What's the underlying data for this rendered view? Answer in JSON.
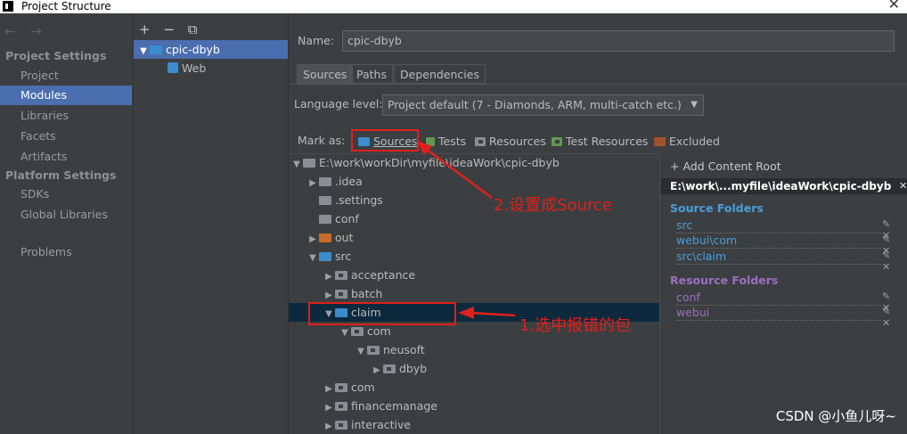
{
  "window": {
    "title": "Project Structure",
    "close_glyph": "✕"
  },
  "sidebar": {
    "nav_arrows": "← →",
    "project_settings_title": "Project Settings",
    "project_settings_items": [
      "Project",
      "Modules",
      "Libraries",
      "Facets",
      "Artifacts"
    ],
    "selected_item": "Modules",
    "platform_settings_title": "Platform Settings",
    "platform_settings_items": [
      "SDKs",
      "Global Libraries"
    ],
    "problems": "Problems"
  },
  "modules_panel": {
    "toolbar": [
      "+",
      "−",
      "⧉"
    ],
    "tree": [
      {
        "label": "cpic-dbyb",
        "selected": true
      },
      {
        "label": "Web",
        "selected": false
      }
    ]
  },
  "module_settings": {
    "name_label": "Name:",
    "name_value": "cpic-dbyb",
    "tabs": [
      "Sources",
      "Paths",
      "Dependencies"
    ],
    "active_tab": "Sources",
    "language_level_label": "Language level:",
    "language_level_value": "Project default (7 - Diamonds, ARM, multi-catch etc.)",
    "mark_as_label": "Mark as:",
    "mark_as_buttons": [
      "Sources",
      "Tests",
      "Resources",
      "Test Resources",
      "Excluded"
    ]
  },
  "file_tree": [
    {
      "label": "E:\\work\\workDir\\myfile\\ideaWork\\cpic-dbyb",
      "indent": 0,
      "arrow": "▼",
      "color": "gray"
    },
    {
      "label": ".idea",
      "indent": 1,
      "arrow": "▶",
      "color": "gray"
    },
    {
      "label": ".settings",
      "indent": 1,
      "arrow": "",
      "color": "gray"
    },
    {
      "label": "conf",
      "indent": 1,
      "arrow": "",
      "color": "gray"
    },
    {
      "label": "out",
      "indent": 1,
      "arrow": "▶",
      "color": "orange"
    },
    {
      "label": "src",
      "indent": 1,
      "arrow": "▼",
      "color": "blue"
    },
    {
      "label": "acceptance",
      "indent": 2,
      "arrow": "▶",
      "color": "pkg"
    },
    {
      "label": "batch",
      "indent": 2,
      "arrow": "▶",
      "color": "pkg"
    },
    {
      "label": "claim",
      "indent": 2,
      "arrow": "▼",
      "color": "blue",
      "selected": true
    },
    {
      "label": "com",
      "indent": 3,
      "arrow": "▼",
      "color": "pkg"
    },
    {
      "label": "neusoft",
      "indent": 4,
      "arrow": "▼",
      "color": "pkg"
    },
    {
      "label": "dbyb",
      "indent": 5,
      "arrow": "▶",
      "color": "pkg"
    },
    {
      "label": "com",
      "indent": 2,
      "arrow": "▶",
      "color": "pkg"
    },
    {
      "label": "financemanage",
      "indent": 2,
      "arrow": "▶",
      "color": "pkg"
    },
    {
      "label": "interactive",
      "indent": 2,
      "arrow": "▶",
      "color": "pkg"
    }
  ],
  "content_roots": {
    "add_label": "+ Add Content Root",
    "root_path": "E:\\work\\...myfile\\ideaWork\\cpic-dbyb",
    "source_folders_title": "Source Folders",
    "source_folders": [
      "src",
      "webui\\com",
      "src\\claim"
    ],
    "resource_folders_title": "Resource Folders",
    "resource_folders": [
      "conf",
      "webui"
    ],
    "entry_tools": "✎ ✕"
  },
  "annotations": {
    "step1": "1.选中报错的包",
    "step2": "2.设置成Source"
  },
  "watermark": "CSDN @小鱼儿呀~",
  "colors": {
    "selection": "#4b6eaf",
    "source_folder_title": "#4a9eda",
    "resource_folder_title": "#9b6fc0",
    "annotation_red": "#e0201b"
  }
}
